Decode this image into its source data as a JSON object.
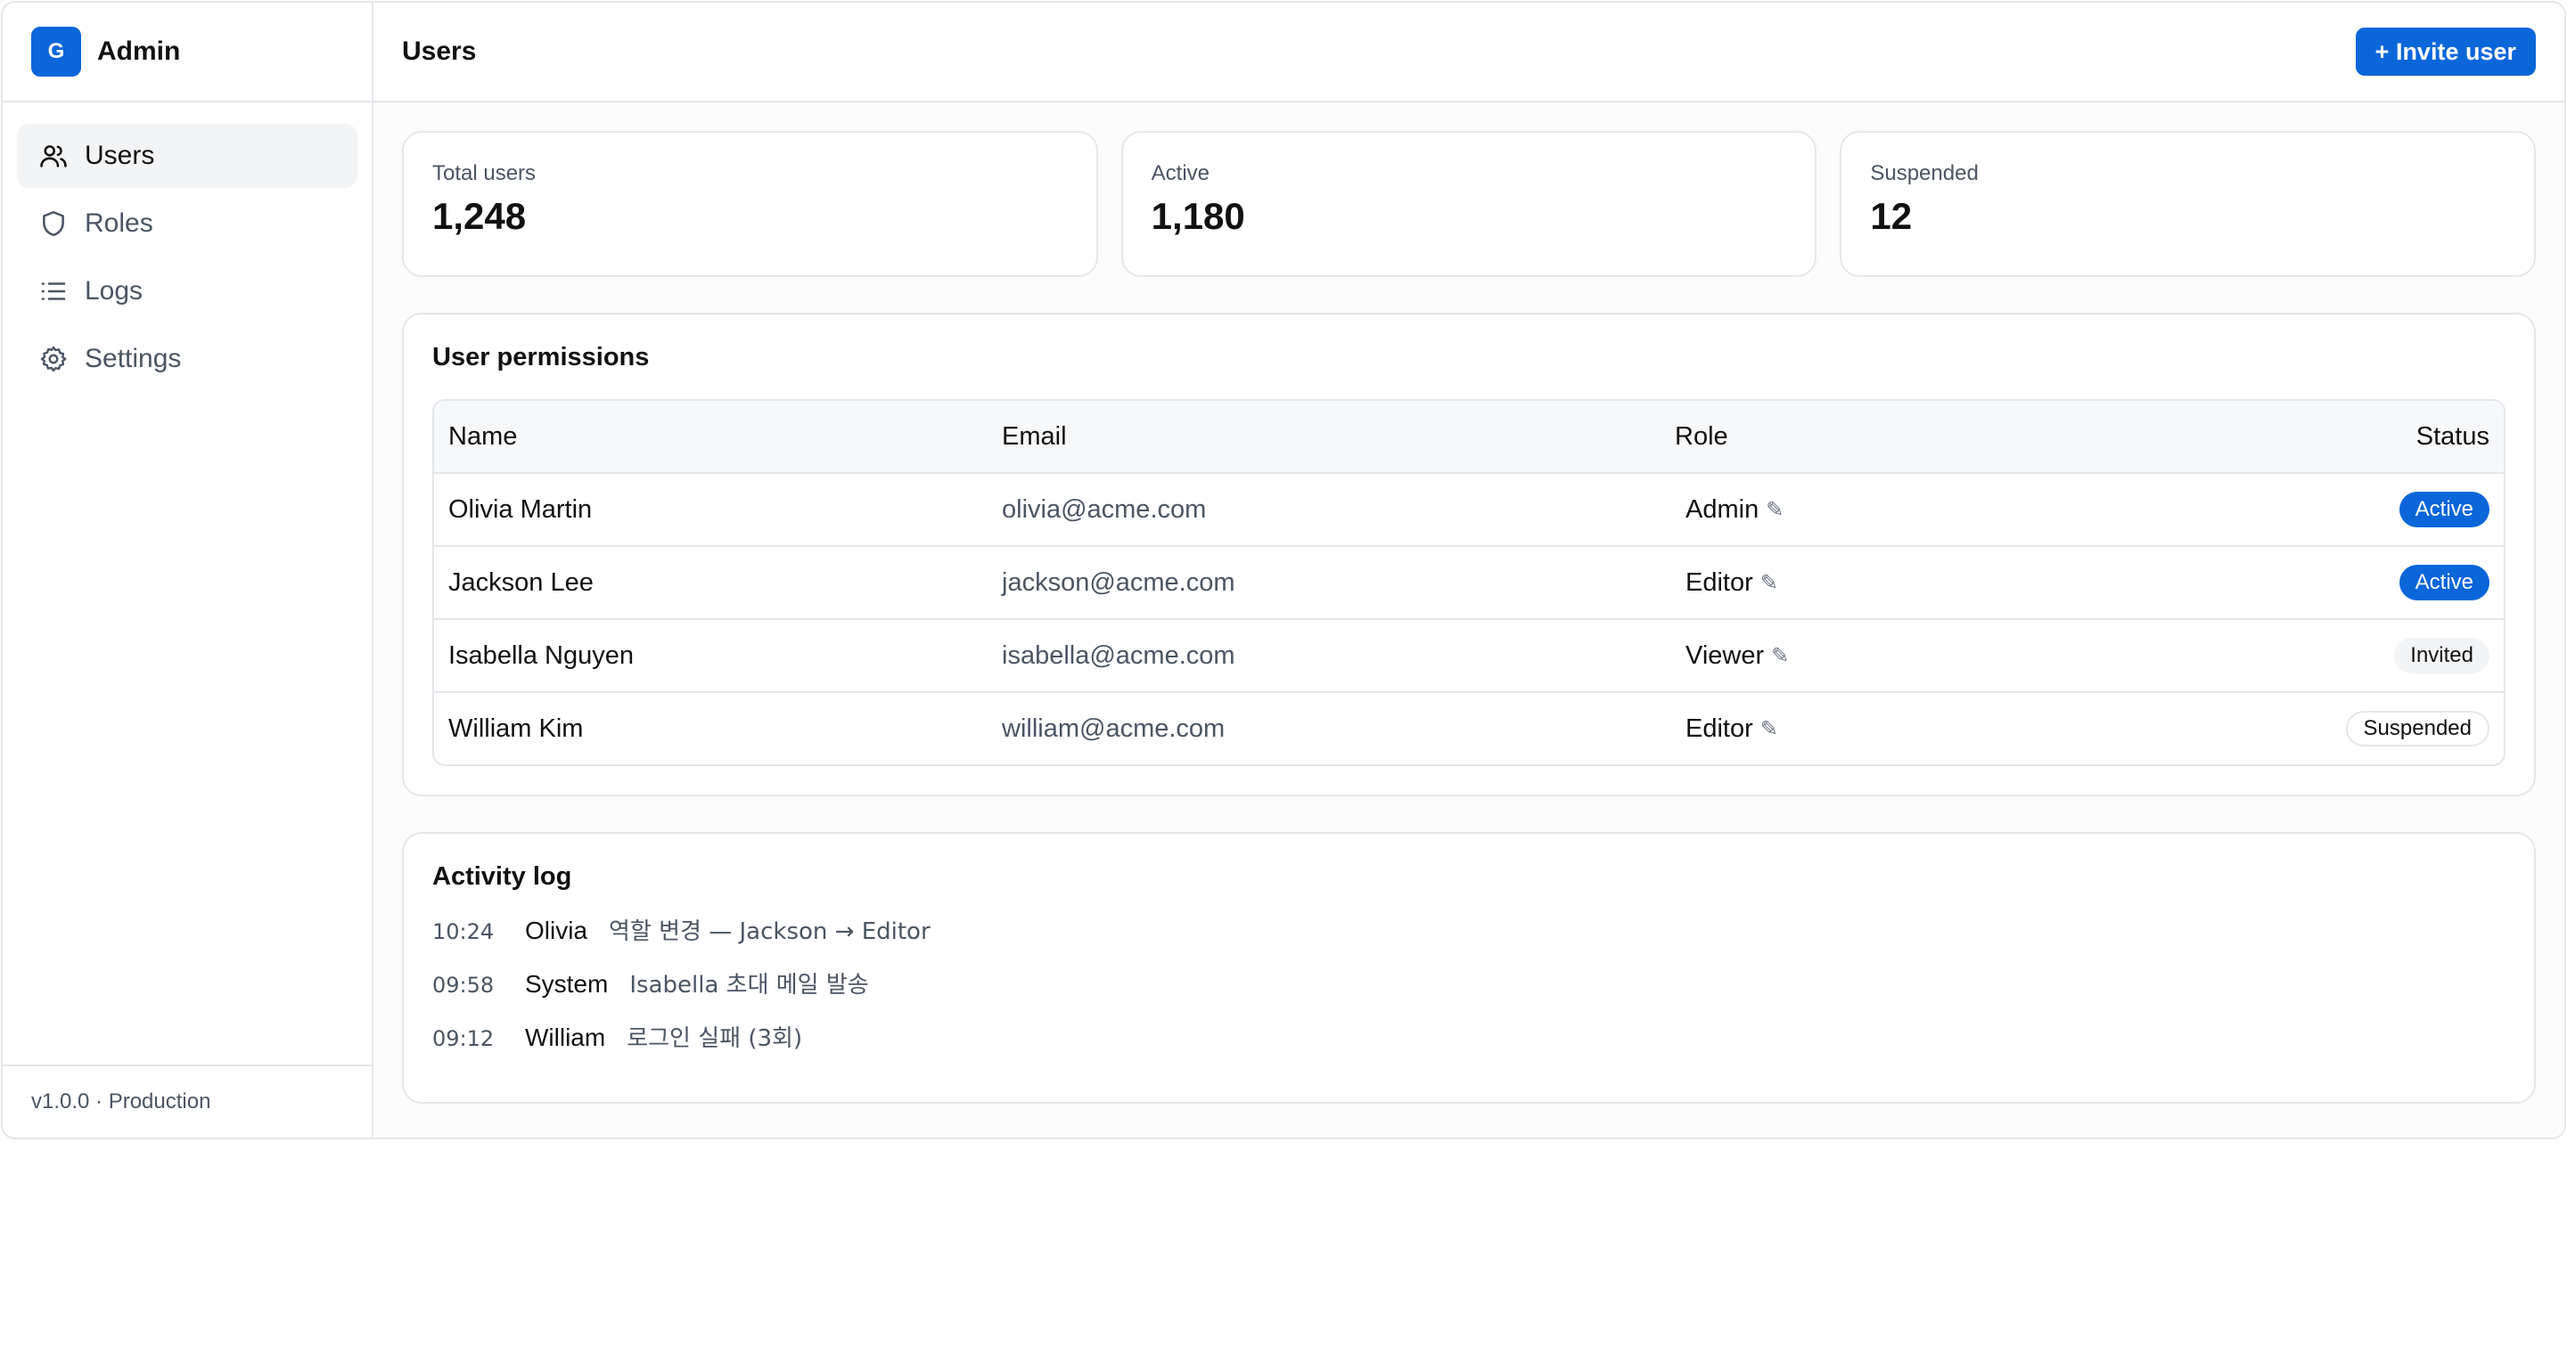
{
  "brand": {
    "logo_letter": "G",
    "title": "Admin",
    "color": "#0a66d9"
  },
  "sidebar": {
    "items": [
      {
        "label": "Users",
        "icon": "users-icon",
        "active": true
      },
      {
        "label": "Roles",
        "icon": "shield-icon",
        "active": false
      },
      {
        "label": "Logs",
        "icon": "list-icon",
        "active": false
      },
      {
        "label": "Settings",
        "icon": "gear-icon",
        "active": false
      }
    ],
    "footer": "v1.0.0 · Production"
  },
  "header": {
    "title": "Users",
    "invite_label": "+ Invite user"
  },
  "stats": [
    {
      "label": "Total users",
      "value": "1,248"
    },
    {
      "label": "Active",
      "value": "1,180"
    },
    {
      "label": "Suspended",
      "value": "12"
    }
  ],
  "permissions": {
    "title": "User permissions",
    "columns": [
      "Name",
      "Email",
      "Role",
      "Status"
    ],
    "rows": [
      {
        "name": "Olivia Martin",
        "email": "olivia@acme.com",
        "role": "Admin",
        "status": "Active",
        "status_kind": "active"
      },
      {
        "name": "Jackson Lee",
        "email": "jackson@acme.com",
        "role": "Editor",
        "status": "Active",
        "status_kind": "active"
      },
      {
        "name": "Isabella Nguyen",
        "email": "isabella@acme.com",
        "role": "Viewer",
        "status": "Invited",
        "status_kind": "invited"
      },
      {
        "name": "William Kim",
        "email": "william@acme.com",
        "role": "Editor",
        "status": "Suspended",
        "status_kind": "suspended"
      }
    ],
    "edit_glyph": "✎"
  },
  "activity": {
    "title": "Activity log",
    "items": [
      {
        "time": "10:24",
        "actor": "Olivia",
        "message": "역할 변경 — Jackson → Editor"
      },
      {
        "time": "09:58",
        "actor": "System",
        "message": "Isabella 초대 메일 발송"
      },
      {
        "time": "09:12",
        "actor": "William",
        "message": "로그인 실패 (3회)"
      }
    ]
  }
}
